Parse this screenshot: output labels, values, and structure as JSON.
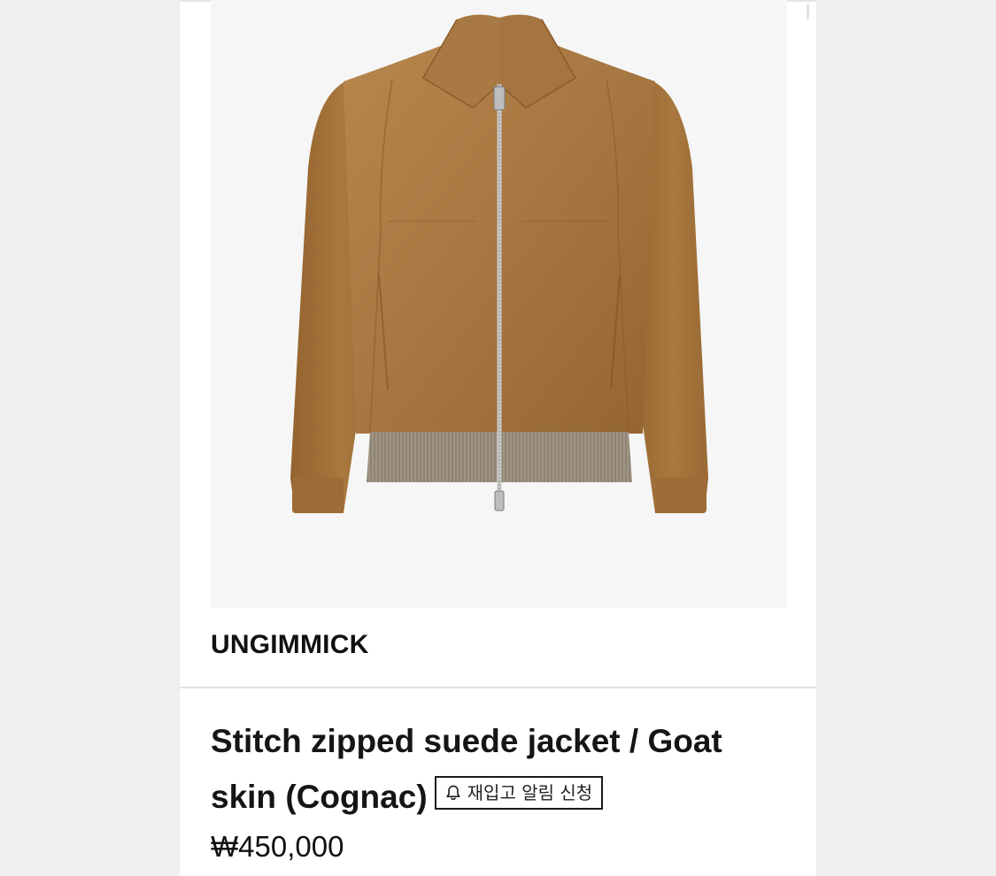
{
  "product": {
    "image_alt": "Suede zip-up jacket in cognac",
    "brand": "UNGIMMICK",
    "title": "Stitch zipped suede jacket / Goat skin (Cognac)",
    "price": "₩450,000",
    "restock_label": "재입고 알림 신청"
  },
  "icons": {
    "restock": "bell-icon"
  },
  "colors": {
    "page_bg": "#efefef",
    "image_bg": "#f6f6f6",
    "suede": "#a77742",
    "rib_knit": "#9b8f80"
  }
}
